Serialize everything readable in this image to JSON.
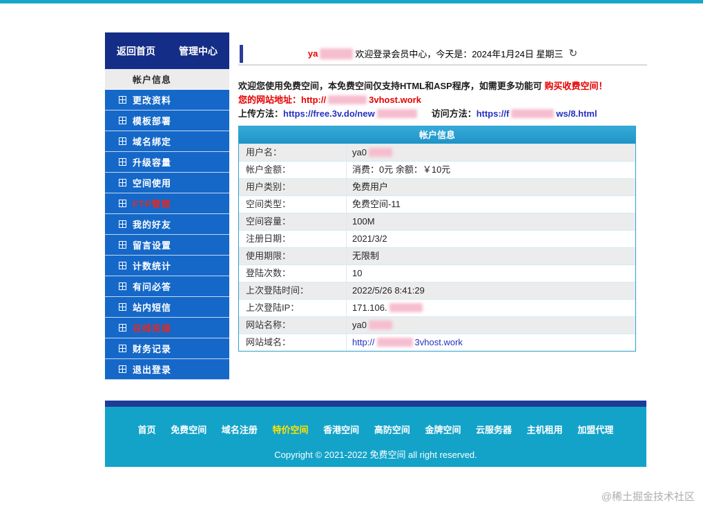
{
  "sidebar": {
    "header_links": [
      "返回首页",
      "管理中心"
    ],
    "items": [
      {
        "label": "帐户信息",
        "active": true
      },
      {
        "label": "更改资料"
      },
      {
        "label": "模板部署"
      },
      {
        "label": "域名绑定"
      },
      {
        "label": "升级容量"
      },
      {
        "label": "空间使用"
      },
      {
        "label": "FTP管理",
        "red": true
      },
      {
        "label": "我的好友"
      },
      {
        "label": "留言设置"
      },
      {
        "label": "计数统计"
      },
      {
        "label": "有问必答"
      },
      {
        "label": "站内短信"
      },
      {
        "label": "在线充值",
        "red": true
      },
      {
        "label": "财务记录"
      },
      {
        "label": "退出登录"
      }
    ]
  },
  "header": {
    "username_prefix": "ya",
    "welcome": "欢迎登录会员中心，今天是：2024年1月24日 星期三",
    "refresh_icon": "↻"
  },
  "notice": {
    "line1": "欢迎您使用免费空间，本免费空间仅支持HTML和ASP程序，如需更多功能可 ",
    "line1_red": "购买收费空间！",
    "line2_label": "您的网站地址：",
    "line2_url_pre": "http://",
    "line2_url_post": "3vhost.work",
    "line3_upload_label": "上传方法：",
    "line3_upload_pre": "https://free.3v.do/new",
    "line3_visit_label": "访问方法：",
    "line3_visit_pre": "https://f",
    "line3_visit_post": "ws/8.html"
  },
  "table": {
    "title": "帐户信息",
    "rows": [
      {
        "label": "用户名：",
        "pre": "ya0",
        "censor": 34
      },
      {
        "label": "帐户金额：",
        "pre": "消费：0元 余额：￥10元"
      },
      {
        "label": "用户类别：",
        "pre": "免费用户"
      },
      {
        "label": "空间类型：",
        "pre": "免费空间-11"
      },
      {
        "label": "空间容量：",
        "pre": "100M"
      },
      {
        "label": "注册日期：",
        "pre": "2021/3/2"
      },
      {
        "label": "使用期限：",
        "pre": "无限制"
      },
      {
        "label": "登陆次数：",
        "pre": "10"
      },
      {
        "label": "上次登陆时间：",
        "pre": "2022/5/26 8:41:29"
      },
      {
        "label": "上次登陆IP：",
        "pre": "171.106.",
        "censor": 48
      },
      {
        "label": "网站名称：",
        "pre": "ya0",
        "censor": 34
      },
      {
        "label": "网站域名：",
        "pre": "http://",
        "censor": 52,
        "post": "3vhost.work",
        "blue": true
      }
    ]
  },
  "footer": {
    "links": [
      {
        "label": "首页"
      },
      {
        "label": "免费空间"
      },
      {
        "label": "域名注册"
      },
      {
        "label": "特价空间",
        "highlight": true
      },
      {
        "label": "香港空间"
      },
      {
        "label": "高防空间"
      },
      {
        "label": "金牌空间"
      },
      {
        "label": "云服务器"
      },
      {
        "label": "主机租用"
      },
      {
        "label": "加盟代理"
      }
    ],
    "copyright": "Copyright © 2021-2022 免费空间 all right reserved."
  },
  "page": {
    "watermark": "@稀土掘金技术社区"
  }
}
